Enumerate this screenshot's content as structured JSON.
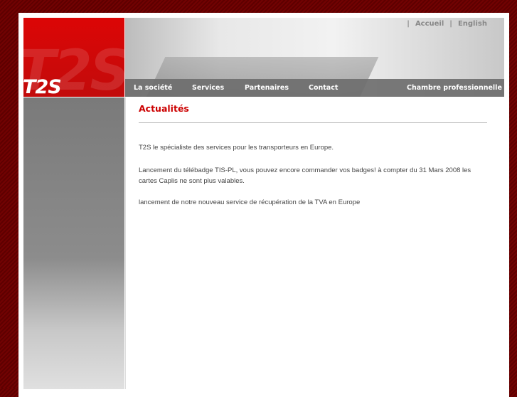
{
  "logo": {
    "text": "T2S"
  },
  "toplinks": {
    "sep": "|",
    "home": "Accueil",
    "english": "English"
  },
  "nav": [
    "La société",
    "Services",
    "Partenaires",
    "Contact",
    "Chambre professionnelle"
  ],
  "content": {
    "title": "Actualités",
    "paragraphs": [
      "T2S le spécialiste des services pour les transporteurs en Europe.",
      "Lancement du télébadge TIS-PL, vous pouvez encore commander vos badges! à compter du 31 Mars 2008 les cartes Caplis ne sont plus valables.",
      "lancement de notre nouveau service de récupération de la TVA en Europe"
    ]
  }
}
